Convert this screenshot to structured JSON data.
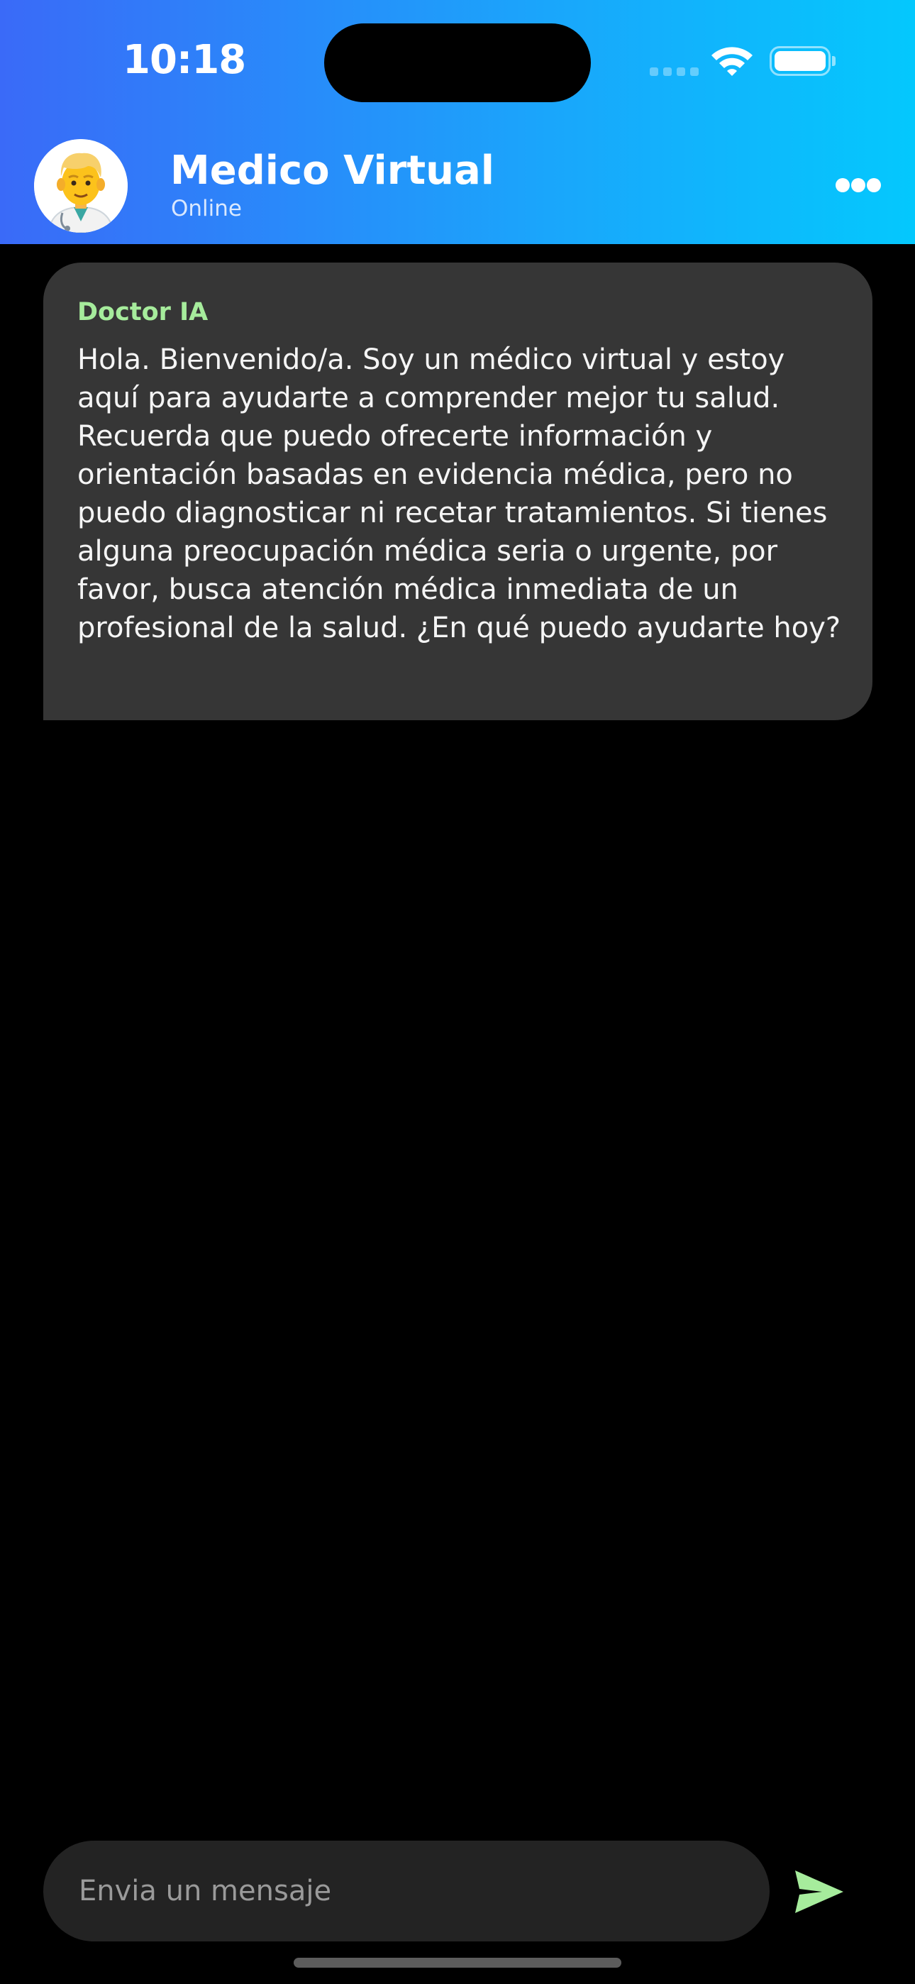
{
  "status_bar": {
    "time": "10:18"
  },
  "header": {
    "title": "Medico Virtual",
    "status": "Online",
    "avatar_icon": "doctor-emoji-icon",
    "more_icon": "more-dots-icon"
  },
  "messages": [
    {
      "sender": "Doctor IA",
      "text": "Hola.  Bienvenido/a.  Soy un médico virtual y estoy\naquí para ayudarte a comprender mejor tu salud.\nRecuerda que puedo ofrecerte información y\norientación basadas en evidencia médica, pero no\npuedo diagnosticar ni recetar tratamientos.  Si tienes\nalguna preocupación médica seria o urgente, por\nfavor, busca atención médica inmediata de un\nprofesional de la salud.  ¿En qué puedo ayudarte hoy?"
    }
  ],
  "composer": {
    "placeholder": "Envia un mensaje",
    "send_icon": "send-icon"
  },
  "colors": {
    "header_gradient_start": "#3a6af8",
    "header_gradient_end": "#04c8fd",
    "sender_name": "#a6ec9c",
    "bubble": "#363636",
    "send_icon": "#a6ec9c"
  }
}
